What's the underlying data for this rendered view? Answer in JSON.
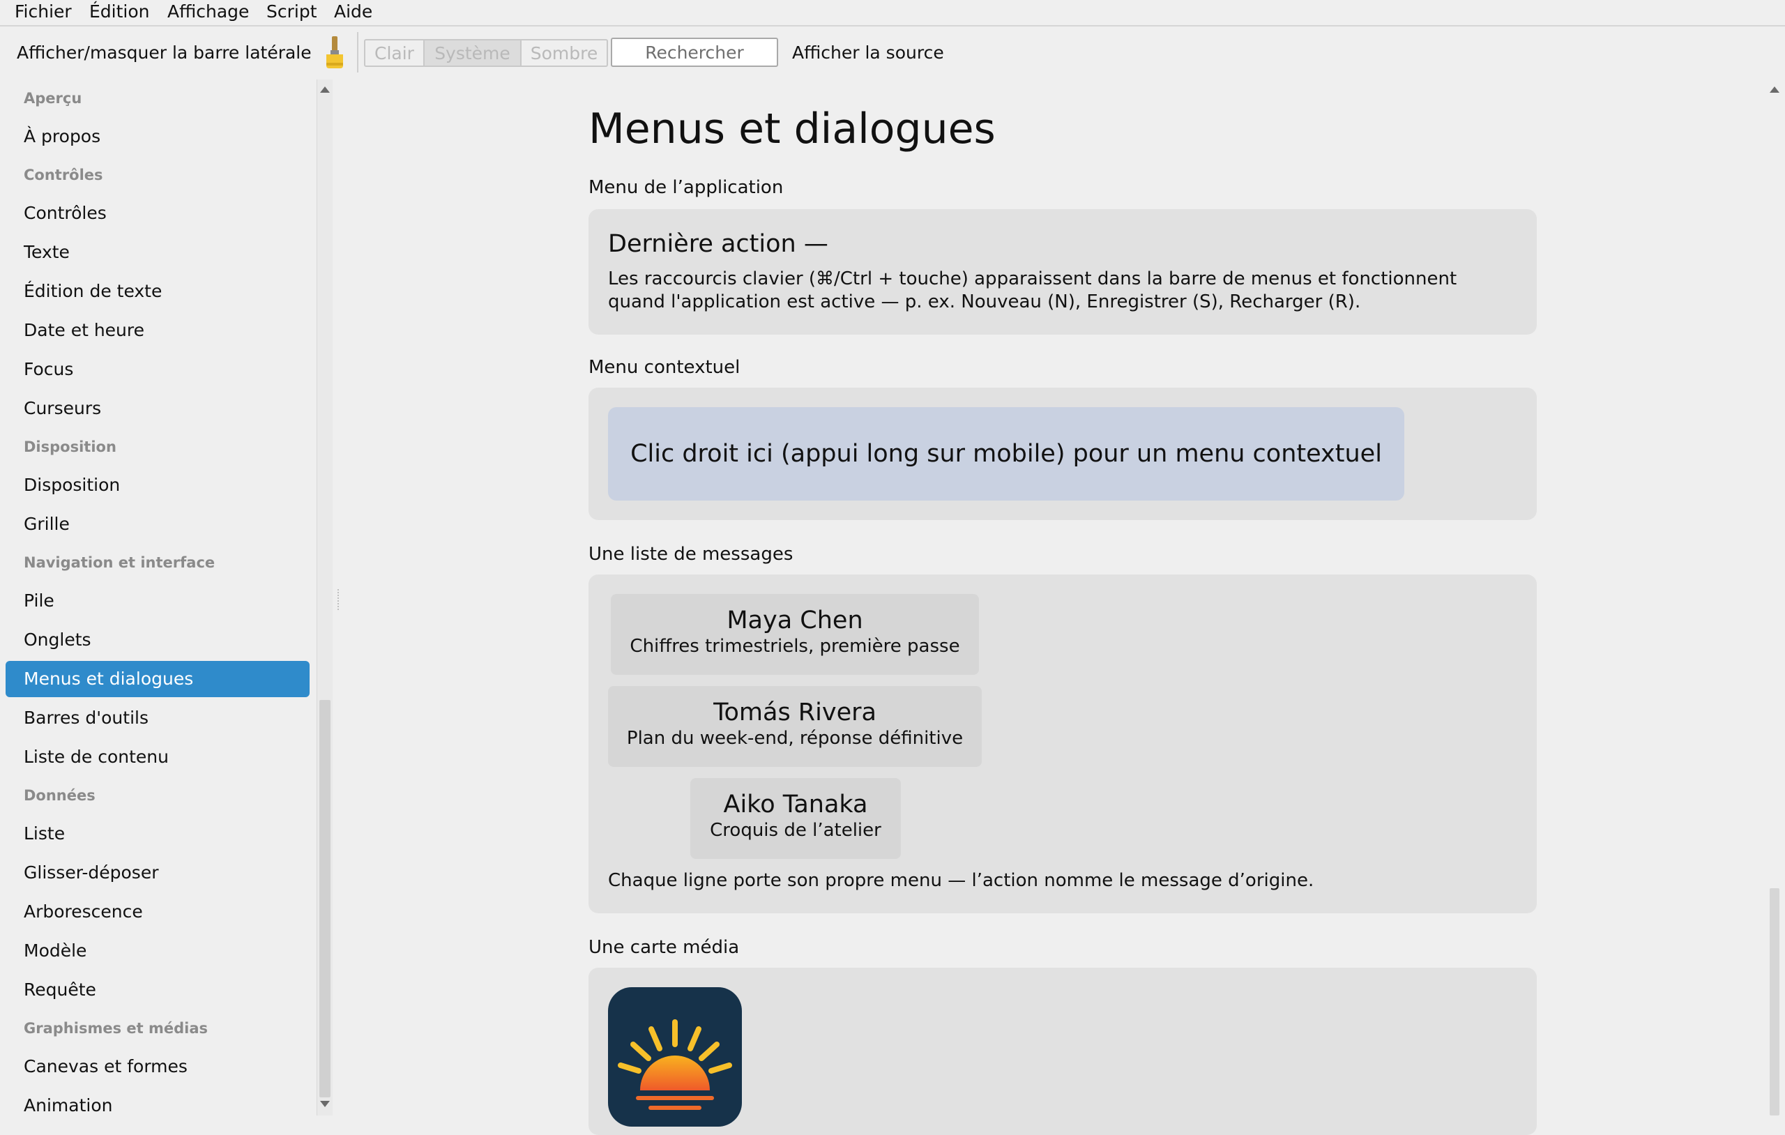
{
  "menubar": {
    "items": [
      "Fichier",
      "Édition",
      "Affichage",
      "Script",
      "Aide"
    ]
  },
  "toolbar": {
    "sidebar_toggle": "Afficher/masquer la barre latérale",
    "theme_options": [
      "Clair",
      "Système",
      "Sombre"
    ],
    "theme_selected": "Système",
    "search_placeholder": "Rechercher",
    "view_source": "Afficher la source"
  },
  "sidebar": {
    "items": [
      {
        "label": "Aperçu",
        "header": true
      },
      {
        "label": "À propos"
      },
      {
        "label": "Contrôles",
        "header": true
      },
      {
        "label": "Contrôles"
      },
      {
        "label": "Texte"
      },
      {
        "label": "Édition de texte"
      },
      {
        "label": "Date et heure"
      },
      {
        "label": "Focus"
      },
      {
        "label": "Curseurs"
      },
      {
        "label": "Disposition",
        "header": true
      },
      {
        "label": "Disposition"
      },
      {
        "label": "Grille"
      },
      {
        "label": "Navigation et interface",
        "header": true
      },
      {
        "label": "Pile"
      },
      {
        "label": "Onglets"
      },
      {
        "label": "Menus et dialogues",
        "selected": true
      },
      {
        "label": "Barres d'outils"
      },
      {
        "label": "Liste de contenu"
      },
      {
        "label": "Données",
        "header": true
      },
      {
        "label": "Liste"
      },
      {
        "label": "Glisser-déposer"
      },
      {
        "label": "Arborescence"
      },
      {
        "label": "Modèle"
      },
      {
        "label": "Requête"
      },
      {
        "label": "Graphismes et médias",
        "header": true
      },
      {
        "label": "Canevas et formes"
      },
      {
        "label": "Animation"
      }
    ]
  },
  "main": {
    "title": "Menus et dialogues",
    "app_menu": {
      "label": "Menu de l’application",
      "last_action": "Dernière action  —",
      "description": "Les raccourcis clavier (⌘/Ctrl + touche) apparaissent dans la barre de menus et fonctionnent quand l'application est active — p. ex. Nouveau (N), Enregistrer (S), Recharger (R)."
    },
    "context_menu": {
      "label": "Menu contextuel",
      "target_text": "Clic droit ici (appui long sur mobile) pour un menu contextuel"
    },
    "message_list": {
      "label": "Une liste de messages",
      "messages": [
        {
          "name": "Maya Chen",
          "subject": "Chiffres trimestriels, première passe"
        },
        {
          "name": "Tomás Rivera",
          "subject": "Plan du week-end, réponse définitive"
        },
        {
          "name": "Aiko Tanaka",
          "subject": "Croquis de l’atelier"
        }
      ],
      "note": "Chaque ligne porte son propre menu — l’action nomme le message d’origine."
    },
    "media_card": {
      "label": "Une carte média",
      "icon": "sunrise-icon"
    }
  },
  "colors": {
    "accent": "#2f8bcb",
    "context_area": "#c9d1e1",
    "card_bg": "#e1e1e1",
    "icon_bg": "#16324a",
    "sun": "#f7a623"
  }
}
